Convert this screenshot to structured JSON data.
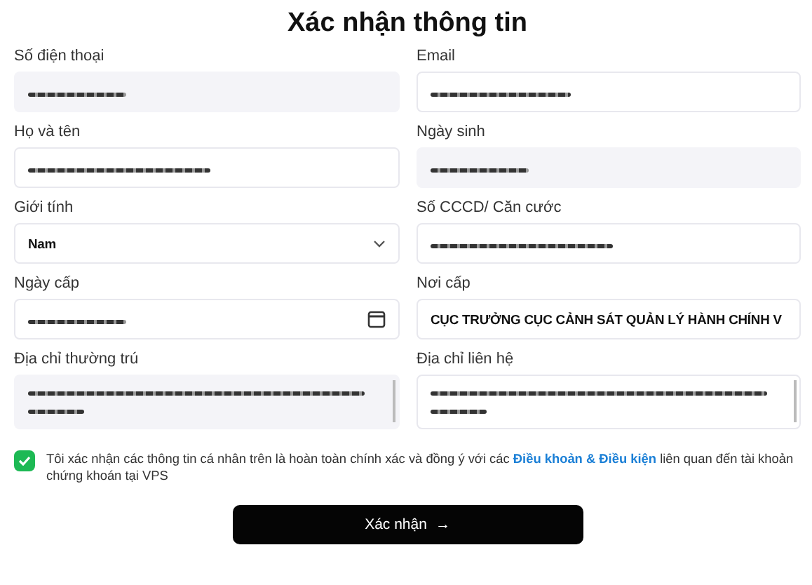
{
  "title": "Xác nhận thông tin",
  "fields": [
    {
      "label": "Số điện thoại",
      "kind": "text",
      "disabled": true,
      "redacted": true
    },
    {
      "label": "Email",
      "kind": "text",
      "disabled": false,
      "redacted": true
    },
    {
      "label": "Họ và tên",
      "kind": "text",
      "disabled": false,
      "redacted": true
    },
    {
      "label": "Ngày sinh",
      "kind": "text",
      "disabled": true,
      "redacted": true
    },
    {
      "label": "Giới tính",
      "kind": "select",
      "disabled": false,
      "value": "Nam"
    },
    {
      "label": "Số CCCD/ Căn cước",
      "kind": "text",
      "disabled": false,
      "redacted": true
    },
    {
      "label": "Ngày cấp",
      "kind": "date",
      "disabled": false,
      "redacted": true
    },
    {
      "label": "Nơi cấp",
      "kind": "text",
      "disabled": false,
      "value": "CỤC TRƯỞNG CỤC CẢNH SÁT QUẢN LÝ HÀNH CHÍNH V"
    },
    {
      "label": "Địa chỉ thường trú",
      "kind": "textarea",
      "disabled": true,
      "redacted": true
    },
    {
      "label": "Địa chỉ liên hệ",
      "kind": "textarea",
      "disabled": false,
      "redacted": true
    }
  ],
  "consent": {
    "checked": true,
    "text": "Tôi xác nhận các thông tin cá nhân trên là hoàn toàn chính xác và đồng ý với các",
    "link": "Điều khoản & Điều kiện",
    "text_after": "liên quan đến tài khoản chứng khoán tại VPS"
  },
  "submit": {
    "label": "Xác nhận",
    "icon": "→"
  }
}
